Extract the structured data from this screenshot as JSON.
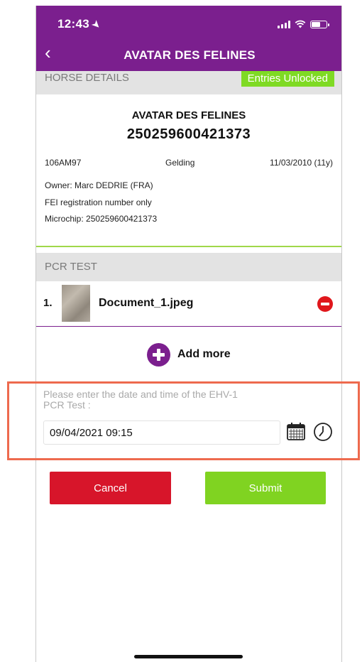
{
  "status_bar": {
    "time": "12:43",
    "location_arrow": "➤"
  },
  "nav": {
    "back_glyph": "‹",
    "title": "AVATAR DES FELINES"
  },
  "horse_details": {
    "header": "HORSE DETAILS",
    "badge": "Entries Unlocked",
    "name": "AVATAR DES FELINES",
    "id": "250259600421373",
    "code": "106AM97",
    "sex": "Gelding",
    "birth_date": "11/03/2010 (11y)",
    "owner": "Owner:  Marc DEDRIE (FRA)",
    "fei": "FEI registration number only",
    "microchip": "Microchip:  250259600421373"
  },
  "pcr_test": {
    "header": "PCR TEST",
    "documents": [
      {
        "index": "1.",
        "name": "Document_1.jpeg"
      }
    ],
    "add_more_label": "Add more"
  },
  "date_entry": {
    "prompt_line1": "Please enter the date and time of the EHV-1",
    "prompt_line2": "PCR Test :",
    "value": "09/04/2021 09:15"
  },
  "actions": {
    "cancel_label": "Cancel",
    "submit_label": "Submit"
  },
  "colors": {
    "brand_purple": "#7b1f8e",
    "badge_green": "#7fda24",
    "cancel_red": "#d7152a",
    "submit_green": "#80d321",
    "remove_red": "#e0171c",
    "highlight_orange": "#ee6a4e"
  },
  "icons": [
    "location-arrow-icon",
    "signal-icon",
    "wifi-icon",
    "battery-icon",
    "back-chevron-icon",
    "remove-icon",
    "plus-icon",
    "calendar-icon",
    "clock-icon"
  ]
}
